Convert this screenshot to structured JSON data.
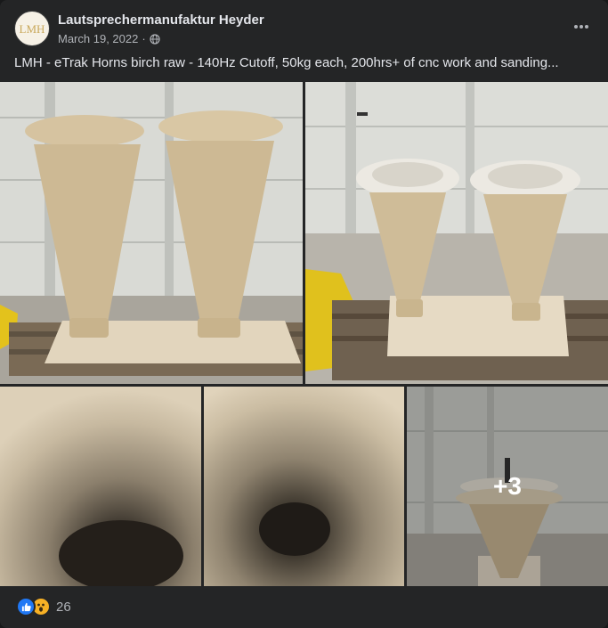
{
  "post": {
    "author": "Lautsprechermanufaktur Heyder",
    "avatar_text": "LMH",
    "date": "March 19, 2022",
    "separator": "·",
    "audience_icon": "globe-icon",
    "text": "LMH - eTrak Horns birch raw - 140Hz Cutoff, 50kg each, 200hrs+ of cnc work and sanding..."
  },
  "photos": {
    "more_count": "+3"
  },
  "reactions": {
    "icons": [
      "like-icon",
      "wow-icon"
    ],
    "count": "26"
  },
  "colors": {
    "card_bg": "#242526",
    "like_blue": "#2078f4",
    "wow_yellow": "#f7b125",
    "text_primary": "#e4e6eb",
    "text_secondary": "#b0b3b8"
  }
}
